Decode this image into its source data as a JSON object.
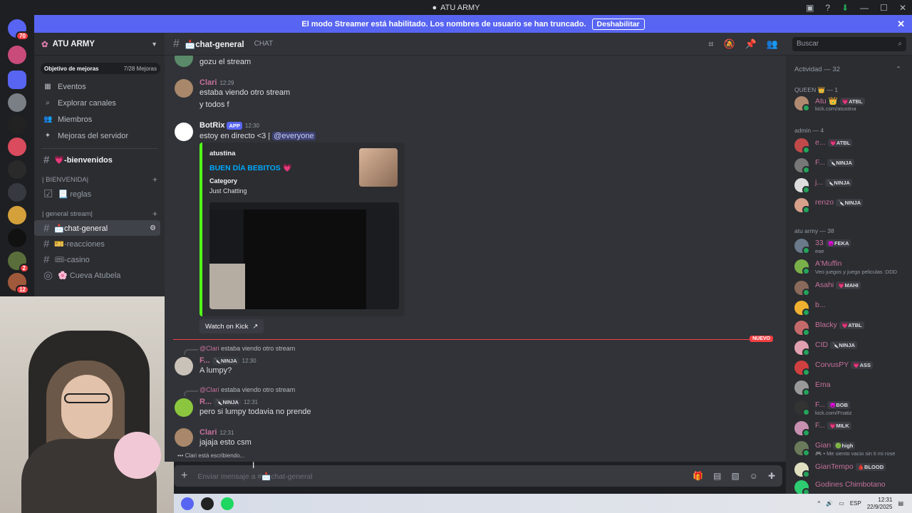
{
  "window": {
    "title": "ATU ARMY",
    "min": "—",
    "max": "☐",
    "close": "✕"
  },
  "banner": {
    "text": "El modo Streamer está habilitado. Los nombres de usuario se han truncado.",
    "button": "Deshabilitar",
    "close": "✕"
  },
  "servers": {
    "badges": [
      "70",
      "2",
      "12"
    ]
  },
  "sidebar": {
    "guild_name": "ATU ARMY",
    "boost_label": "Objetivo de mejoras",
    "boost_progress": "7/28 Mejoras",
    "items": [
      {
        "icon": "▦",
        "label": "Eventos"
      },
      {
        "icon": "⌕",
        "label": "Explorar canales"
      },
      {
        "icon": "👥",
        "label": "Miembros"
      },
      {
        "icon": "✦",
        "label": "Mejoras del servidor"
      }
    ],
    "channel_welcome": "💗-bienvenidos",
    "category_1": "| BIENVENIDA|",
    "channel_rules": "📃 reglas",
    "category_2": "| general stream|",
    "channels": [
      "📩chat-general",
      "🎫-reacciones",
      "🎟-casino",
      "🌸 Cueva Atubela"
    ]
  },
  "header": {
    "channel": "📩chat-general",
    "sub": "CHAT",
    "search_placeholder": "Buscar"
  },
  "messages": {
    "m0": {
      "text": "gozu el stream"
    },
    "m1": {
      "author": "Clari",
      "time": "12:29",
      "line1": "estaba viendo otro stream",
      "line2": "y todos f"
    },
    "m2": {
      "author": "BotRix",
      "tag": "APP",
      "time": "12:30",
      "text": "estoy en directo <3 |",
      "mention": "@everyone"
    },
    "embed": {
      "author": "atustina",
      "title": "BUEN DÍA BEBITOS 💗",
      "field_name": "Category",
      "field_value": "Just Chatting",
      "button": "Watch on Kick"
    },
    "new_label": "NUEVO",
    "m3": {
      "reply_name": "@Clari",
      "reply_text": "estaba viendo otro stream",
      "author": "F...",
      "tag": "🔪NINJA",
      "time": "12:30",
      "text": "A lumpy?"
    },
    "m4": {
      "reply_name": "@Clari",
      "reply_text": "estaba viendo otro stream",
      "author": "R...",
      "tag": "🔪NINJA",
      "time": "12:31",
      "text": "pero si lumpy todavia no prende"
    },
    "m5": {
      "author": "Clari",
      "time": "12:31",
      "text": "jajaja esto csm"
    },
    "typing": "Clari está escribiendo..."
  },
  "composer": {
    "placeholder": "Enviar mensaje a #📩chat-general"
  },
  "members": {
    "header": "Actividad — 32",
    "categories": [
      "QUEEN 👑 — 1",
      "admin — 4",
      "atu army — 38"
    ],
    "list": [
      {
        "name": "Atu 👑",
        "tag": "💗ATBL",
        "sub": "kick.com/atustina"
      },
      {
        "name": "e...",
        "tag": "💗ATBL",
        "sub": ""
      },
      {
        "name": "F...",
        "tag": "🔪NINJA",
        "sub": ""
      },
      {
        "name": "j...",
        "tag": "🔪NINJA",
        "sub": ""
      },
      {
        "name": "renzo",
        "tag": "🔪NINJA",
        "sub": ""
      },
      {
        "name": "33",
        "tag": "😈FEKA",
        "sub": "eae"
      },
      {
        "name": "A'Muffin",
        "tag": "",
        "sub": "Veo juegos y juego peliculas :DDD"
      },
      {
        "name": "Asahi",
        "tag": "💗MAHI",
        "sub": ""
      },
      {
        "name": "b...",
        "tag": "",
        "sub": ""
      },
      {
        "name": "Blacky",
        "tag": "💗ATBL",
        "sub": ""
      },
      {
        "name": "CID",
        "tag": "🔪NINJA",
        "sub": ""
      },
      {
        "name": "CorvusPY",
        "tag": "💗ASS",
        "sub": ""
      },
      {
        "name": "Ema",
        "tag": "",
        "sub": ""
      },
      {
        "name": "F...",
        "tag": "😈BOB",
        "sub": "kick.com/Fnatiz"
      },
      {
        "name": "F...",
        "tag": "💗MILK",
        "sub": ""
      },
      {
        "name": "Gian",
        "tag": "🟢high",
        "sub": "🎮 • Me siento vacio sin ti mi rose"
      },
      {
        "name": "GianTempo",
        "tag": "🩸BLOOD",
        "sub": ""
      },
      {
        "name": "Godines Chimbotano",
        "tag": "",
        "sub": ""
      }
    ]
  },
  "taskbar": {
    "lang": "ESP",
    "time": "12:31",
    "date": "22/9/2025"
  },
  "colors": {
    "accent": "#5865f2",
    "kick_green": "#53fc18",
    "new_red": "#f23f43",
    "role_pink": "#c6719b"
  }
}
